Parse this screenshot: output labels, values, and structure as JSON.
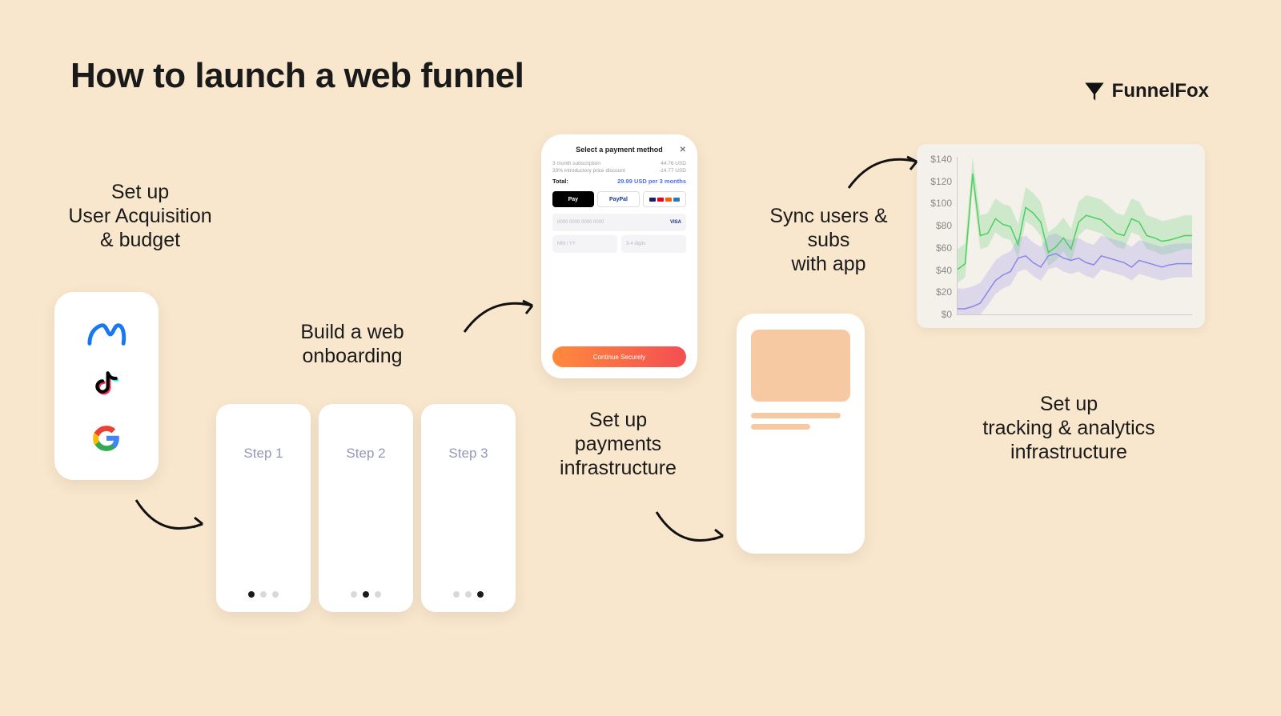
{
  "title": "How to launch a web funnel",
  "brand": "FunnelFox",
  "captions": {
    "ua": "Set up\nUser Acquisition\n& budget",
    "onb": "Build a web\nonboarding",
    "pay": "Set up\npayments\ninfrastructure",
    "sync": "Sync users &\nsubs\nwith app",
    "trk": "Set up\ntracking & analytics\ninfrastructure"
  },
  "ua_icons": [
    "meta-icon",
    "tiktok-icon",
    "google-icon"
  ],
  "steps": [
    "Step 1",
    "Step 2",
    "Step 3"
  ],
  "payment": {
    "header": "Select a payment method",
    "rows": [
      {
        "l": "3 month subscription",
        "r": "44.76 USD"
      },
      {
        "l": "33% introductory price discount",
        "r": "-14.77 USD"
      }
    ],
    "total_label": "Total:",
    "total_value": "29.99 USD per 3 months",
    "pay_buttons": {
      "apple": "Pay",
      "paypal": "PayPal"
    },
    "inputs": {
      "card": "0000  0000  0000  0000",
      "card_brand": "VISA",
      "exp": "MM / YY",
      "cvv": "3-4 digits"
    },
    "cta": "Continue Securely"
  },
  "chart_data": {
    "type": "line",
    "ylabel": "$",
    "ylim": [
      0,
      140
    ],
    "yticks": [
      "$140",
      "$120",
      "$100",
      "$80",
      "$60",
      "$40",
      "$20",
      "$0"
    ],
    "series": [
      {
        "name": "green",
        "color": "#4bcf5f",
        "values": [
          40,
          45,
          125,
          70,
          72,
          85,
          80,
          78,
          62,
          95,
          90,
          82,
          55,
          60,
          68,
          58,
          82,
          88,
          86,
          84,
          78,
          72,
          70,
          85,
          82,
          70,
          68,
          65,
          66,
          68,
          70,
          70
        ]
      },
      {
        "name": "purple",
        "color": "#8b86e7",
        "values": [
          5,
          5,
          7,
          10,
          20,
          30,
          35,
          38,
          50,
          52,
          46,
          42,
          52,
          54,
          50,
          48,
          50,
          46,
          44,
          52,
          50,
          48,
          46,
          42,
          48,
          46,
          44,
          42,
          44,
          45,
          45,
          45
        ]
      }
    ],
    "area_bands": true
  }
}
